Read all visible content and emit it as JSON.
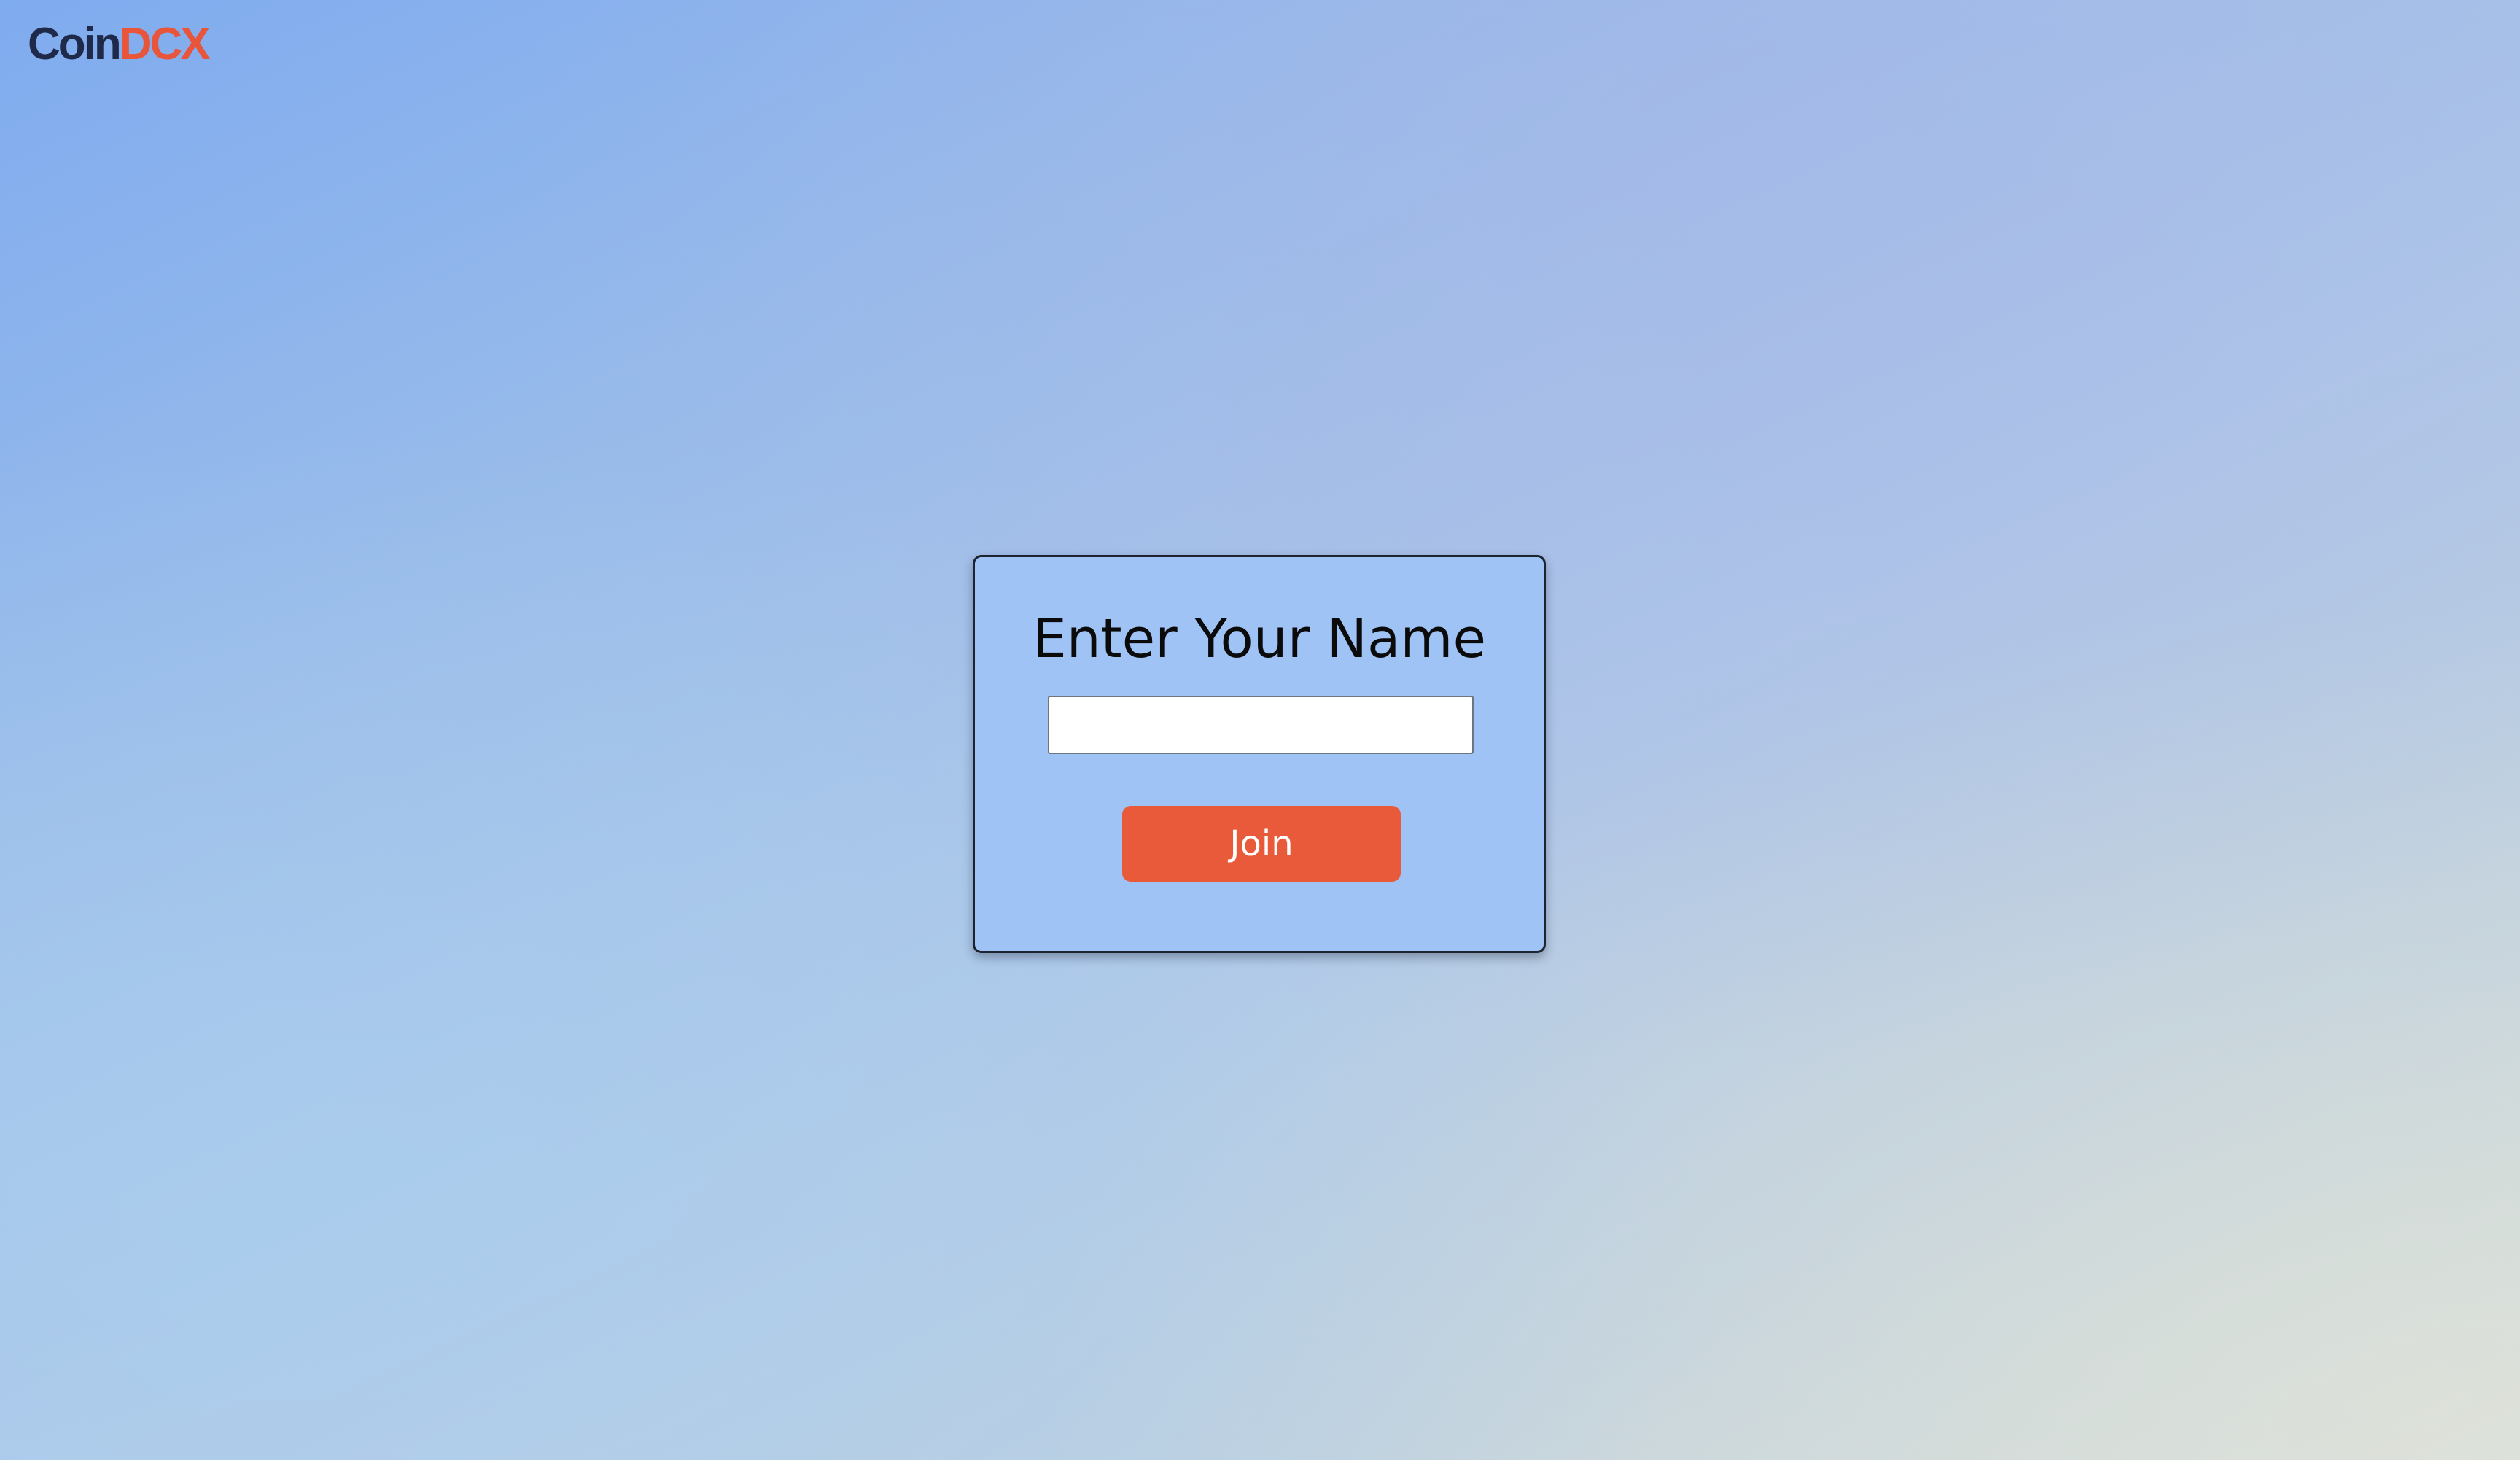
{
  "brand": {
    "logo_part1": "Coin",
    "logo_part2": "DCX",
    "colors": {
      "coin": "#1f2a4b",
      "dcx": "#e8553a"
    }
  },
  "form": {
    "title": "Enter Your Name",
    "name_input": {
      "value": "",
      "placeholder": ""
    },
    "join_label": "Join",
    "colors": {
      "card_background": "#9fc3f5",
      "button_background": "#e85a39",
      "button_text": "#ffffff"
    }
  }
}
